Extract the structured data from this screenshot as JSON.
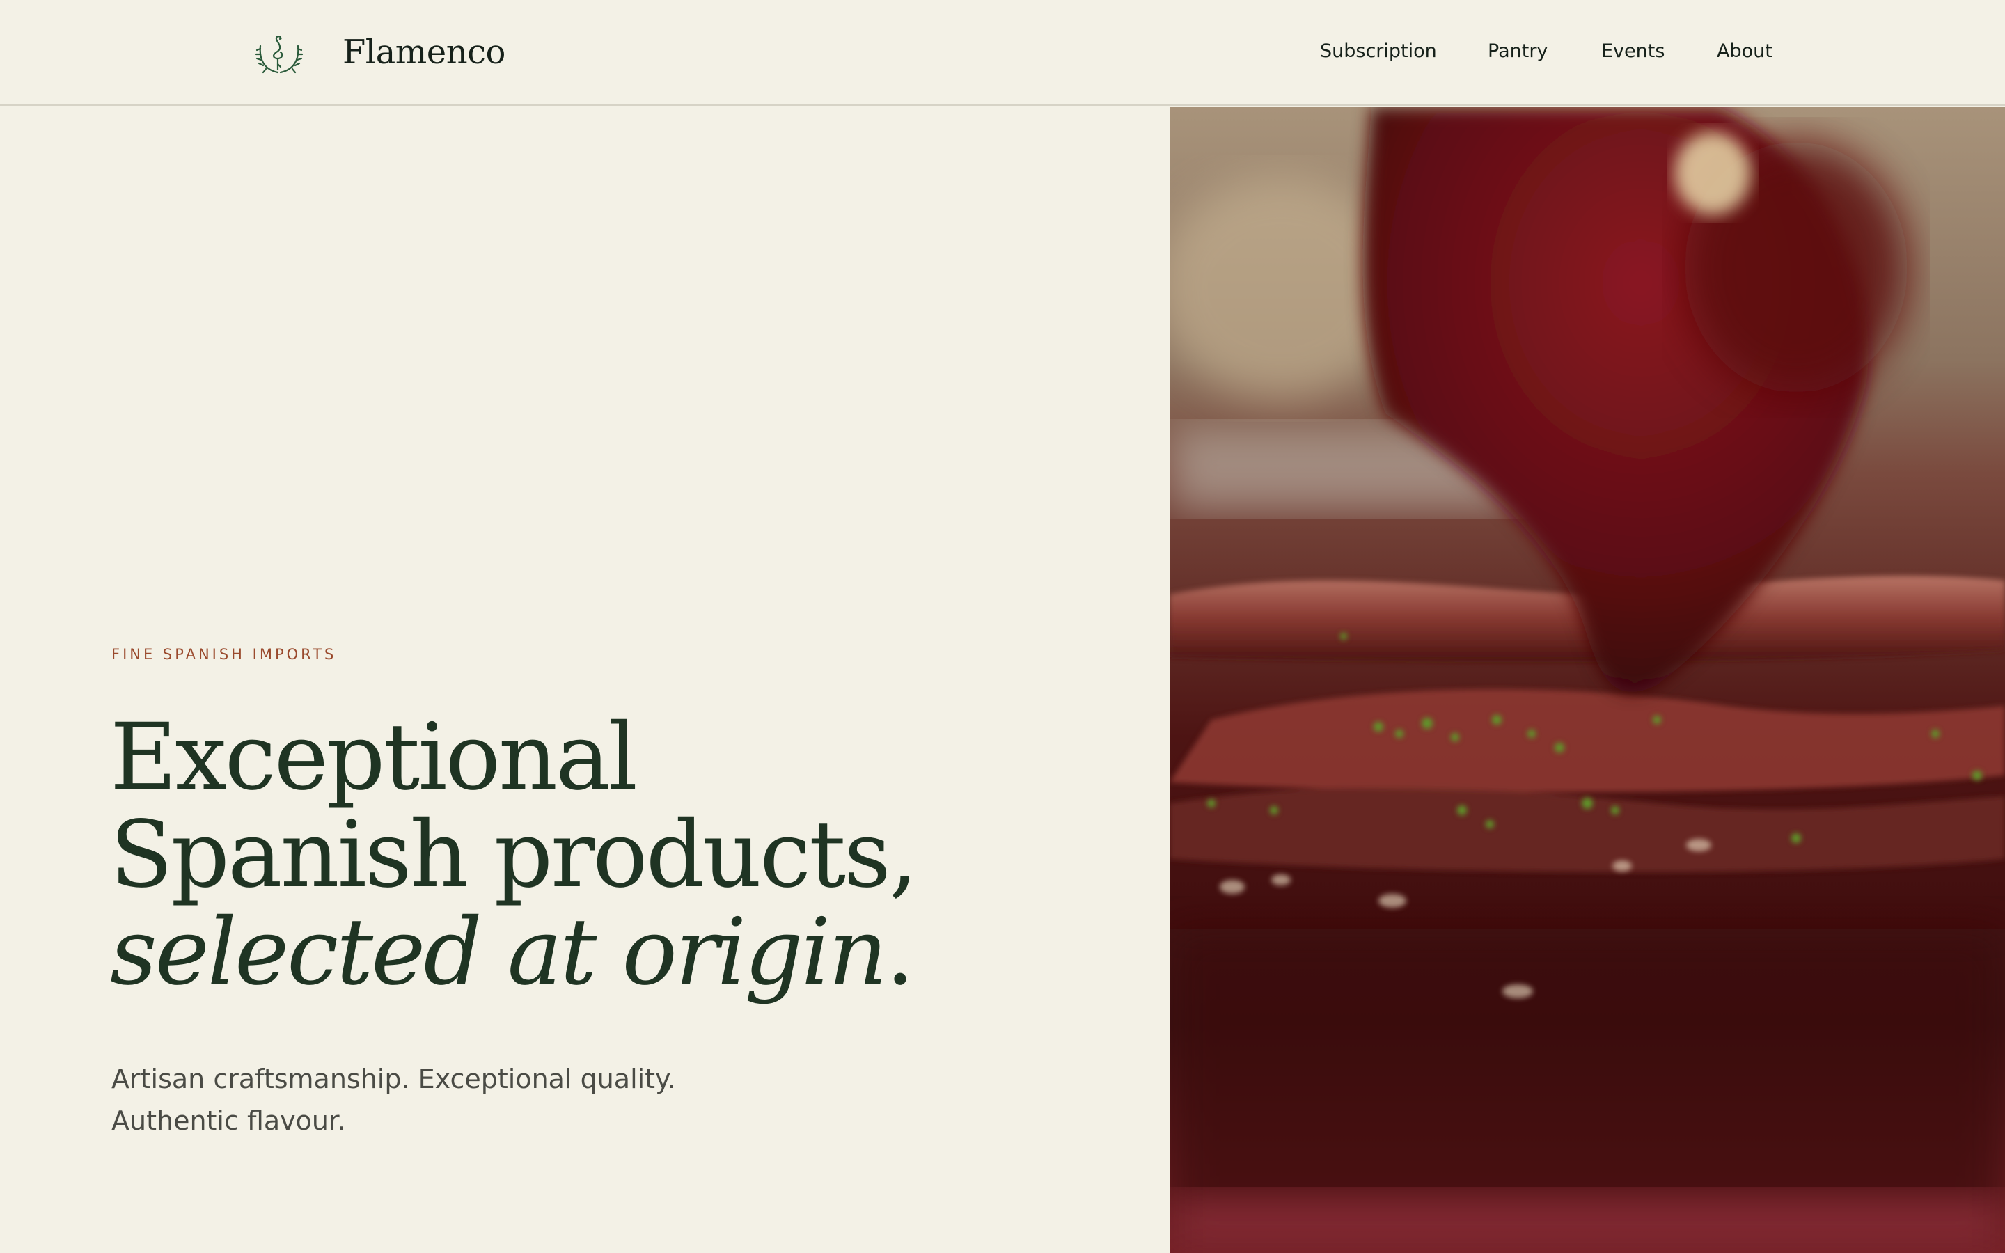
{
  "header": {
    "brand": "Flamenco",
    "logo_icon": "flamingo-laurel-logo-icon",
    "nav": [
      {
        "label": "Subscription"
      },
      {
        "label": "Pantry"
      },
      {
        "label": "Events"
      },
      {
        "label": "About"
      }
    ]
  },
  "hero": {
    "eyebrow": "FINE SPANISH IMPORTS",
    "headline": {
      "line1": "Exceptional",
      "line2": "Spanish products,",
      "line3_italic": "selected at origin",
      "line3_end": "."
    },
    "subtext": {
      "line1": "Artisan craftsmanship. Exceptional quality.",
      "line2": "Authentic flavour."
    },
    "media_subject": "anchovy-fillets-video-image"
  },
  "colors": {
    "background": "#f3f1e6",
    "headline": "#1f3423",
    "eyebrow": "#9a4a2d",
    "nav_text": "#16211a",
    "logo": "#2a5a3a"
  }
}
